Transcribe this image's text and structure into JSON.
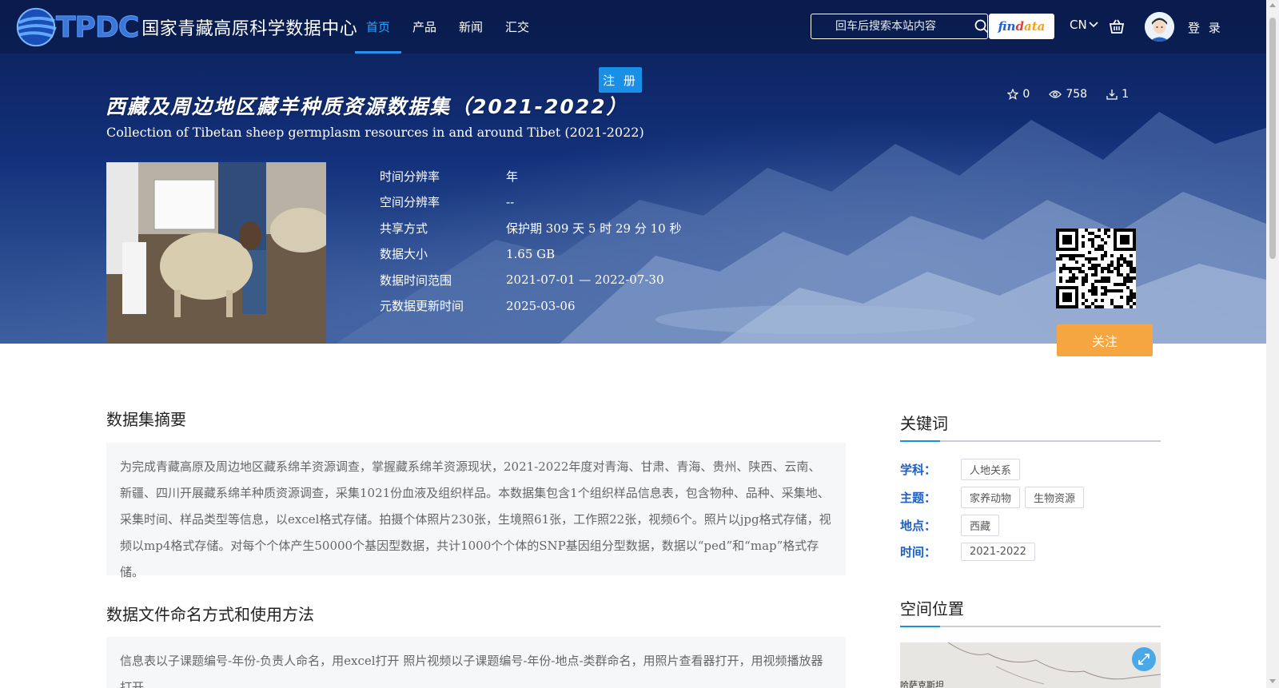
{
  "header": {
    "logo_abbr": "TPDC",
    "logo_name": "国家青藏高原科学数据中心",
    "nav": [
      {
        "label": "首页",
        "active": true
      },
      {
        "label": "产品",
        "active": false
      },
      {
        "label": "新闻",
        "active": false
      },
      {
        "label": "汇交",
        "active": false
      }
    ],
    "search_placeholder": "回车后搜索本站内容",
    "findata": {
      "p1": "fin",
      "p2": "d",
      "p3": "ata"
    },
    "lang": "CN",
    "login": "登 录",
    "register": "注 册"
  },
  "dataset": {
    "title_cn": "西藏及周边地区藏羊种质资源数据集（2021-2022）",
    "title_en": "Collection of Tibetan sheep germplasm resources in and around Tibet (2021-2022)",
    "stats": {
      "favorites": "0",
      "views": "758",
      "downloads": "1"
    },
    "meta": [
      {
        "label": "时间分辨率",
        "value": "年"
      },
      {
        "label": "空间分辨率",
        "value": "--"
      },
      {
        "label": "共享方式",
        "value": "保护期 309 天 5 时 29 分 10 秒"
      },
      {
        "label": "数据大小",
        "value": "1.65 GB"
      },
      {
        "label": "数据时间范围",
        "value": "2021-07-01 — 2022-07-30"
      },
      {
        "label": "元数据更新时间",
        "value": "2025-03-06"
      }
    ],
    "follow": "关注"
  },
  "abstract": {
    "title": "数据集摘要",
    "text": "为完成青藏高原及周边地区藏系绵羊资源调查，掌握藏系绵羊资源现状，2021-2022年度对青海、甘肃、青海、贵州、陕西、云南、新疆、四川开展藏系绵羊种质资源调查，采集1021份血液及组织样品。本数据集包含1个组织样品信息表，包含物种、品种、采集地、采集时间、样品类型等信息，以excel格式存储。拍摄个体照片230张，生境照61张，工作照22张，视频6个。照片以jpg格式存储，视频以mp4格式存储。对每个个体产生50000个基因型数据，共计1000个个体的SNP基因组分型数据，数据以“ped”和“map”格式存储。"
  },
  "naming": {
    "title": "数据文件命名方式和使用方法",
    "text": "信息表以子课题编号-年份-负责人命名，用excel打开 照片视频以子课题编号-年份-地点-类群命名，用照片查看器打开，用视频播放器打开。"
  },
  "keywords": {
    "title": "关键词",
    "rows": [
      {
        "label": "学科：",
        "tags": [
          "人地关系"
        ]
      },
      {
        "label": "主题：",
        "tags": [
          "家养动物",
          "生物资源"
        ]
      },
      {
        "label": "地点：",
        "tags": [
          "西藏"
        ]
      },
      {
        "label": "时间：",
        "tags": [
          "2021-2022"
        ]
      }
    ]
  },
  "location": {
    "title": "空间位置",
    "map_label": "哈萨克斯坦"
  },
  "colors": {
    "accent": "#1a8fe6",
    "follow": "#f5a641",
    "keyword_label": "#1a5fc8"
  }
}
